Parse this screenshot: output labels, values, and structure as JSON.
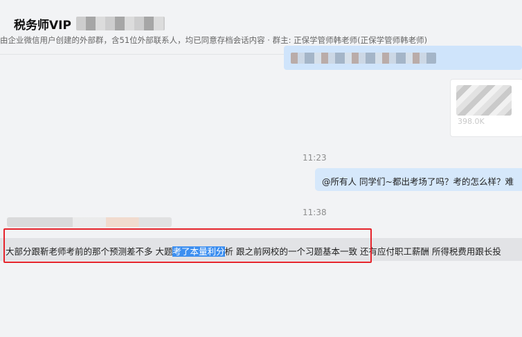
{
  "header": {
    "group_title": "税务师VIP",
    "description": "由企业微信用户创建的外部群，含51位外部联系人，均已同意存档会话内容  · 群主: 正保学管师韩老师(正保学管师韩老师)"
  },
  "messages": {
    "file_size": "398.0K",
    "time_1": "11:23",
    "right_message": "@所有人  同学们~都出考场了吗？考的怎么样？难",
    "time_2": "11:38",
    "left_message": {
      "before": "大部分跟靳老师考前的那个预测差不多 大题",
      "highlighted": "考了本量利分",
      "after": "析 跟之前网校的一个习题基本一致 还有应付职工薪酬 所得税费用跟长投"
    }
  },
  "colors": {
    "background": "#f2f3f5",
    "self_bubble": "#d6e8fb",
    "highlight": "#3d8ff0",
    "annotation_box": "#e5232b"
  }
}
